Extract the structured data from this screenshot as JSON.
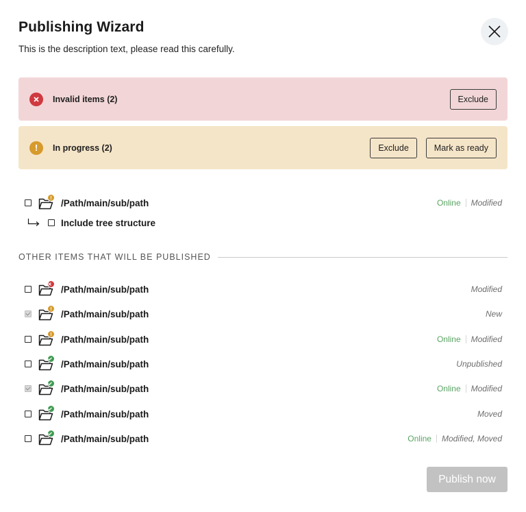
{
  "dialog": {
    "title": "Publishing Wizard",
    "description": "This is the description text, please read this carefully."
  },
  "banners": {
    "invalid": {
      "text": "Invalid items (2)",
      "icon": "x-icon",
      "exclude_label": "Exclude"
    },
    "in_progress": {
      "text": "In progress (2)",
      "icon": "exclamation-icon",
      "exclude_label": "Exclude",
      "mark_ready_label": "Mark as ready"
    }
  },
  "primary_item": {
    "path": "/Path/main/sub/path",
    "checked": false,
    "badge": "warning",
    "online": "Online",
    "status": "Modified",
    "tree_label": "Include tree structure"
  },
  "section": {
    "title": "OTHER ITEMS THAT WILL BE PUBLISHED"
  },
  "items": [
    {
      "path": "/Path/main/sub/path",
      "checked": false,
      "badge": "error",
      "online": "",
      "status": "Modified"
    },
    {
      "path": "/Path/main/sub/path",
      "checked": true,
      "badge": "warning",
      "online": "",
      "status": "New"
    },
    {
      "path": "/Path/main/sub/path",
      "checked": false,
      "badge": "warning",
      "online": "Online",
      "status": "Modified"
    },
    {
      "path": "/Path/main/sub/path",
      "checked": false,
      "badge": "ok",
      "online": "",
      "status": "Unpublished"
    },
    {
      "path": "/Path/main/sub/path",
      "checked": true,
      "badge": "ok",
      "online": "Online",
      "status": "Modified"
    },
    {
      "path": "/Path/main/sub/path",
      "checked": false,
      "badge": "ok",
      "online": "",
      "status": "Moved"
    },
    {
      "path": "/Path/main/sub/path",
      "checked": false,
      "badge": "ok",
      "online": "Online",
      "status": "Modified, Moved"
    }
  ],
  "footer": {
    "publish_label": "Publish now"
  },
  "colors": {
    "error": "#d0393e",
    "warning": "#d69a2d",
    "ok": "#3f9a52",
    "online": "#5aa463",
    "error_bg": "#f2d6d7",
    "warning_bg": "#f5e5c8"
  }
}
